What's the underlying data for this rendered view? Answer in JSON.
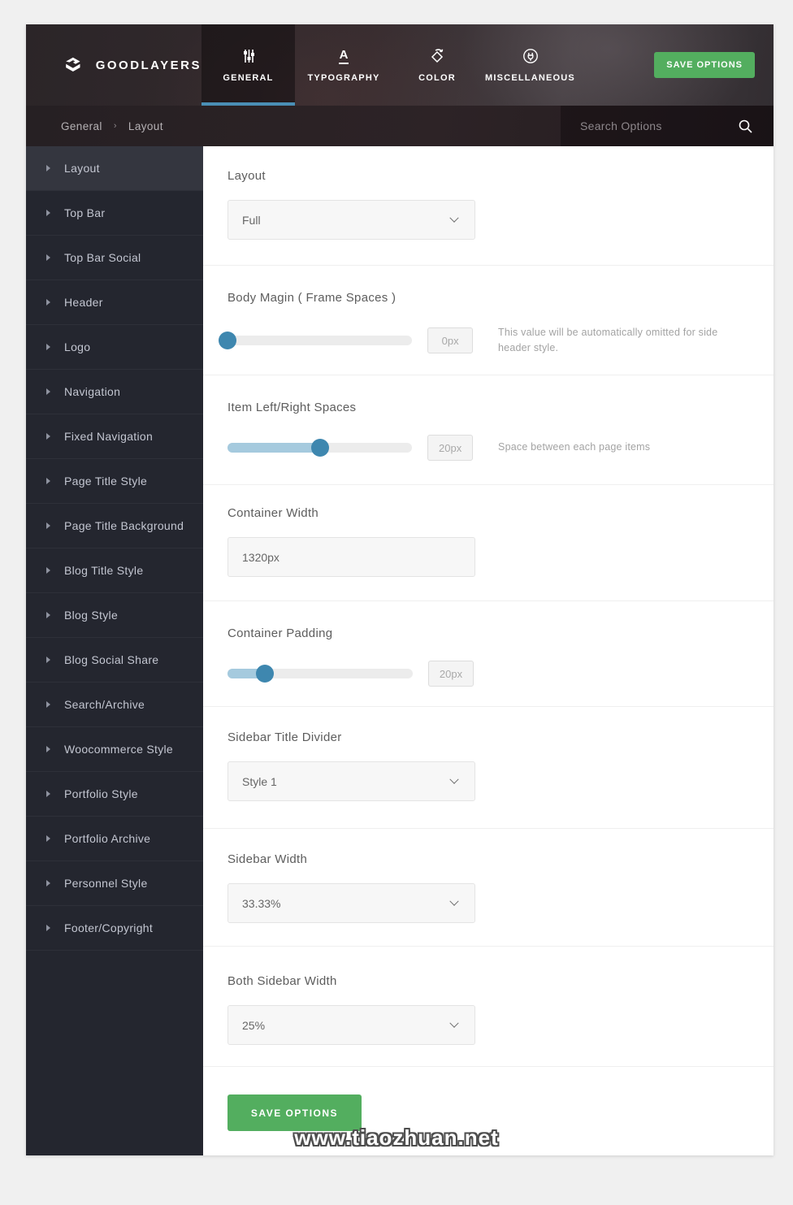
{
  "header": {
    "logo_text": "GOODLAYERS",
    "tabs": [
      {
        "label": "GENERAL",
        "icon": "sliders-icon",
        "active": true
      },
      {
        "label": "TYPOGRAPHY",
        "icon": "typography-icon",
        "active": false
      },
      {
        "label": "COLOR",
        "icon": "paint-bucket-icon",
        "active": false
      },
      {
        "label": "MISCELLANEOUS",
        "icon": "plug-icon",
        "active": false
      }
    ],
    "save_button": "SAVE OPTIONS"
  },
  "breadcrumb": {
    "items": [
      "General",
      "Layout"
    ],
    "separator": "›"
  },
  "search": {
    "placeholder": "Search Options"
  },
  "sidebar": {
    "active_index": 0,
    "items": [
      "Layout",
      "Top Bar",
      "Top Bar Social",
      "Header",
      "Logo",
      "Navigation",
      "Fixed Navigation",
      "Page Title Style",
      "Page Title Background",
      "Blog Title Style",
      "Blog Style",
      "Blog Social Share",
      "Search/Archive",
      "Woocommerce Style",
      "Portfolio Style",
      "Portfolio Archive",
      "Personnel Style",
      "Footer/Copyright"
    ]
  },
  "main": {
    "layout": {
      "label": "Layout",
      "value": "Full"
    },
    "body_margin": {
      "label": "Body Magin ( Frame Spaces )",
      "value": "0px",
      "percent": 0,
      "desc": "This value will be automatically omitted for side header style."
    },
    "item_spaces": {
      "label": "Item Left/Right Spaces",
      "value": "20px",
      "percent": 50,
      "desc": "Space between each page items"
    },
    "container_width": {
      "label": "Container Width",
      "value": "1320px"
    },
    "container_padding": {
      "label": "Container Padding",
      "value": "20px",
      "percent": 20
    },
    "sidebar_title_divider": {
      "label": "Sidebar Title Divider",
      "value": "Style 1"
    },
    "sidebar_width": {
      "label": "Sidebar Width",
      "value": "33.33%"
    },
    "both_sidebar_width": {
      "label": "Both Sidebar Width",
      "value": "25%"
    }
  },
  "footer": {
    "save_button": "SAVE OPTIONS"
  },
  "watermark": "www.tiaozhuan.net",
  "colors": {
    "accent_blue": "#4a8fb5",
    "slider_handle": "#3e87af",
    "slider_fill": "#a5cade",
    "save_green": "#53ae5f",
    "sidebar_bg": "#24262f",
    "header_dark": "#2b2528"
  }
}
